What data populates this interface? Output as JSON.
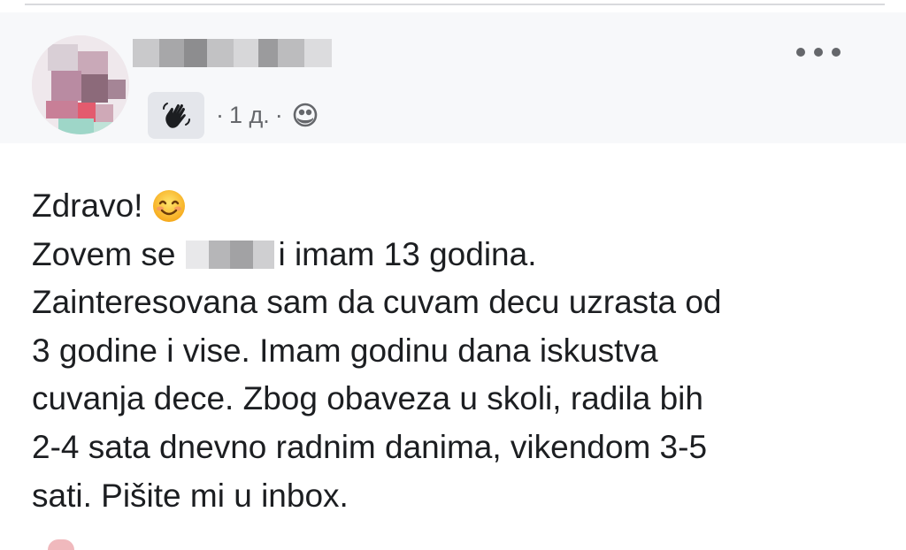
{
  "post": {
    "audience_icon": "wave-hand-icon",
    "time": "1 д.",
    "separator": "·",
    "privacy_icon": "globe-icon",
    "more_icon": "more-options-icon",
    "lines": {
      "l1": "Zdravo!",
      "l2a": "Zovem se",
      "l2b": "i imam 13 godina.",
      "l3": "Zainteresovana sam da cuvam decu uzrasta od",
      "l4": "3 godine i vise. Imam godinu dana iskustva",
      "l5": "cuvanja dece. Zbog obaveza u skoli, radila bih",
      "l6": "2-4 sata dnevno radnim danima, vikendom 3-5",
      "l7": "sati. Pišite mi u inbox."
    }
  }
}
